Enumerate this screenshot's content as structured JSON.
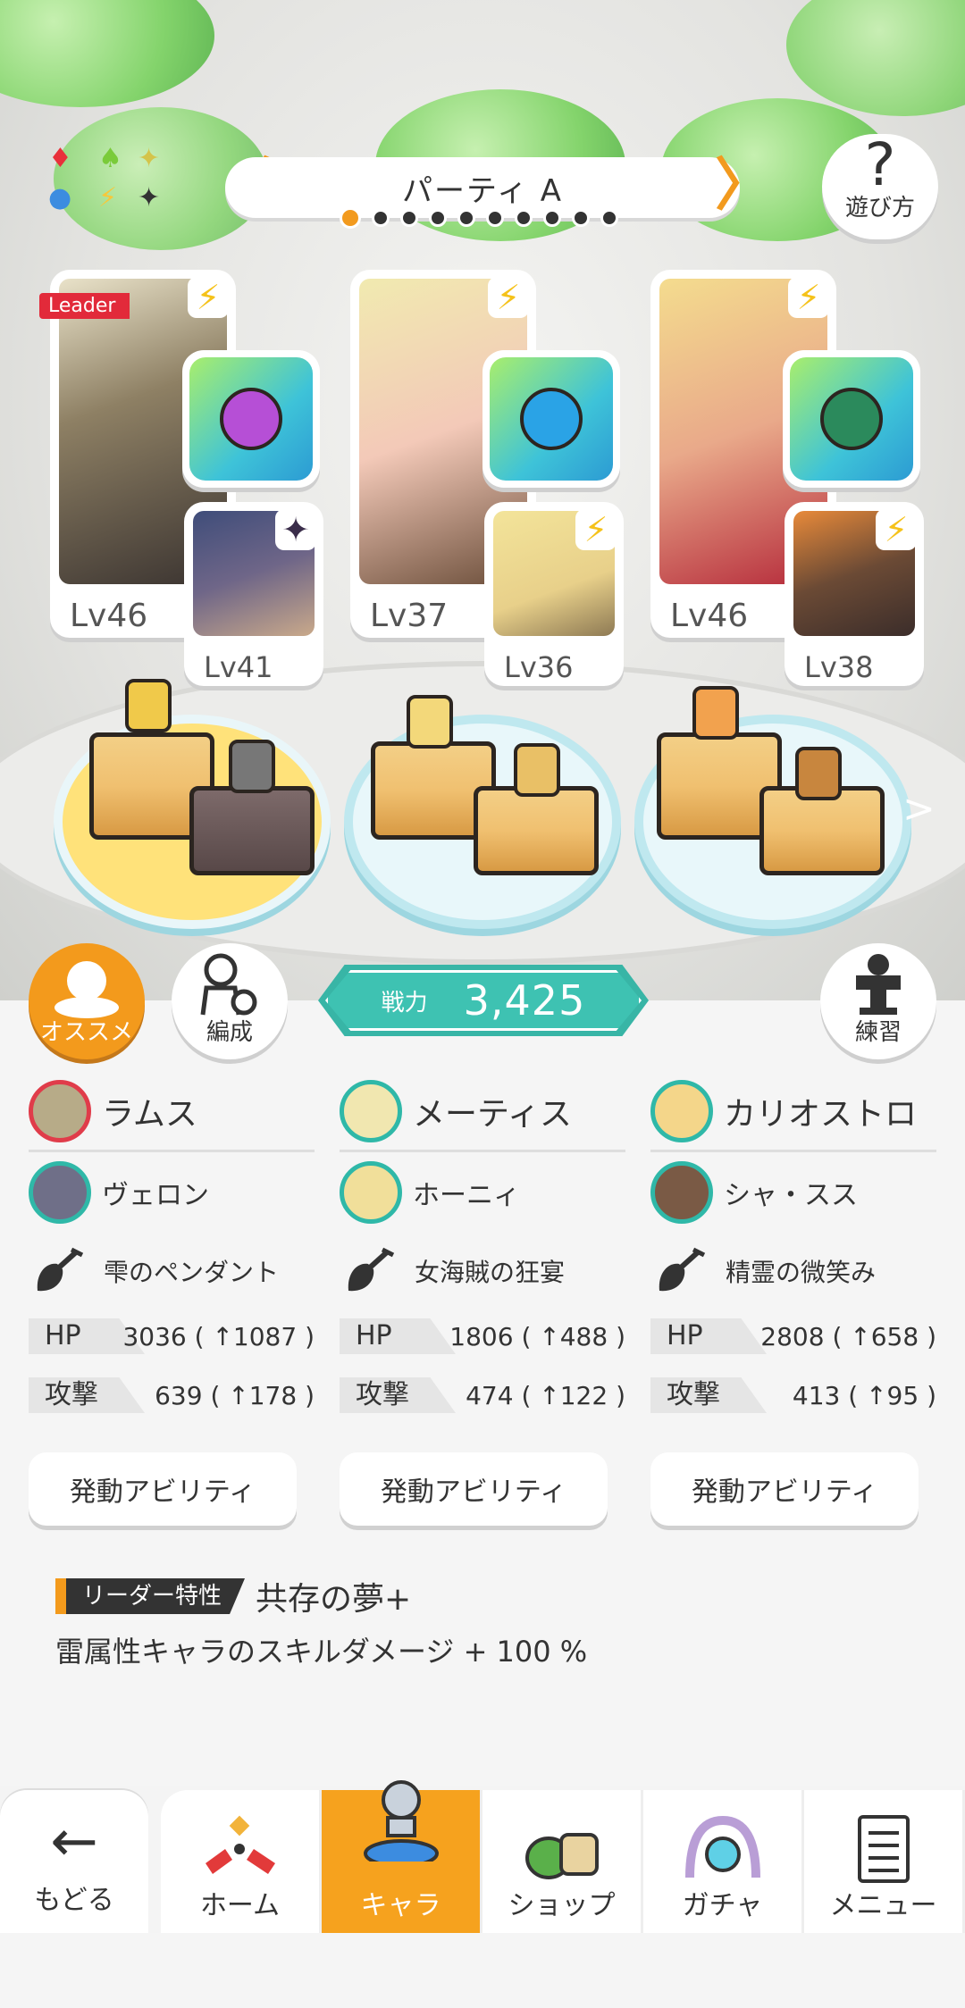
{
  "header": {
    "party_name": "パーティ A",
    "prev_label": "〈",
    "next_label": "〉",
    "page_dots": 10,
    "active_dot": 0,
    "help_label": "遊び方",
    "help_icon_glyph": "?"
  },
  "elements": {
    "glyphs": [
      "♦",
      "♠",
      "✦",
      "●",
      "⚡",
      "✦"
    ],
    "colors": [
      "#e8303a",
      "#7acb3a",
      "#f5e37a",
      "#3c8ce0",
      "#f7c83a",
      "#333333"
    ]
  },
  "party": [
    {
      "main_level": "Lv46",
      "sub_level": "Lv41",
      "is_leader": true,
      "leader_label": "Leader",
      "main_element": "⚡",
      "sub_element": "✦",
      "equip_color": "#b64fd6"
    },
    {
      "main_level": "Lv37",
      "sub_level": "Lv36",
      "is_leader": false,
      "main_element": "⚡",
      "sub_element": "⚡",
      "equip_color": "#2aa3e6"
    },
    {
      "main_level": "Lv46",
      "sub_level": "Lv38",
      "is_leader": false,
      "main_element": "⚡",
      "sub_element": "⚡",
      "equip_color": "#2b8a5c"
    }
  ],
  "scene": {
    "next_arrow": ">"
  },
  "actions": {
    "recommend_label": "オススメ",
    "formation_label": "編成",
    "practice_label": "練習"
  },
  "power": {
    "label": "戦力",
    "value": "3,425"
  },
  "columns": [
    {
      "main_name": "ラムス",
      "sub_name": "ヴェロン",
      "equipment": "雫のペンダント",
      "hp_label": "HP",
      "hp_value": "3036 ( ↑1087 )",
      "atk_label": "攻撃",
      "atk_value": "639 ( ↑178 )",
      "ability_label": "発動アビリティ"
    },
    {
      "main_name": "メーティス",
      "sub_name": "ホーニィ",
      "equipment": "女海賊の狂宴",
      "hp_label": "HP",
      "hp_value": "1806 ( ↑488 )",
      "atk_label": "攻撃",
      "atk_value": "474 ( ↑122 )",
      "ability_label": "発動アビリティ"
    },
    {
      "main_name": "カリオストロ",
      "sub_name": "シャ・スス",
      "equipment": "精霊の微笑み",
      "hp_label": "HP",
      "hp_value": "2808 ( ↑658 )",
      "atk_label": "攻撃",
      "atk_value": "413 ( ↑95 )",
      "ability_label": "発動アビリティ"
    }
  ],
  "leader": {
    "badge": "リーダー特性",
    "skill_name": "共存の夢+",
    "description": "雷属性キャラのスキルダメージ + 100 %"
  },
  "nav": {
    "back_label": "もどる",
    "back_arrow": "←",
    "tabs": [
      {
        "label": "ホーム",
        "icon": "home-icon"
      },
      {
        "label": "キャラ",
        "icon": "character-icon"
      },
      {
        "label": "ショップ",
        "icon": "shop-icon"
      },
      {
        "label": "ガチャ",
        "icon": "gacha-icon"
      },
      {
        "label": "メニュー",
        "icon": "menu-icon"
      }
    ],
    "active_tab": 1
  },
  "colors": {
    "accent": "#f39a1c",
    "teal": "#3ec2b2",
    "leader_red": "#e22a3a"
  }
}
